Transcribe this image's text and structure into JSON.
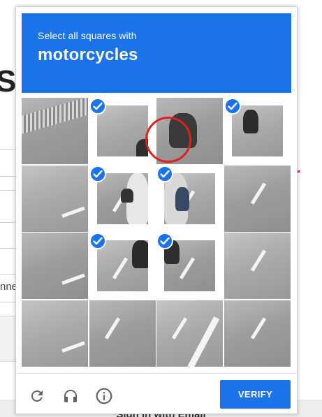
{
  "background_page": {
    "heading_fragment": "Sig",
    "input_fragment": "nne",
    "bottom_button_fragment": "Sign in with Email"
  },
  "captcha": {
    "instruction_line1": "Select all squares with",
    "instruction_target": "motorcycles",
    "tiles": [
      {
        "row": 1,
        "col": 1,
        "selected": false
      },
      {
        "row": 1,
        "col": 2,
        "selected": true
      },
      {
        "row": 1,
        "col": 3,
        "selected": false
      },
      {
        "row": 1,
        "col": 4,
        "selected": true
      },
      {
        "row": 2,
        "col": 1,
        "selected": false
      },
      {
        "row": 2,
        "col": 2,
        "selected": true
      },
      {
        "row": 2,
        "col": 3,
        "selected": true
      },
      {
        "row": 2,
        "col": 4,
        "selected": false
      },
      {
        "row": 3,
        "col": 1,
        "selected": false
      },
      {
        "row": 3,
        "col": 2,
        "selected": true
      },
      {
        "row": 3,
        "col": 3,
        "selected": true
      },
      {
        "row": 3,
        "col": 4,
        "selected": false
      },
      {
        "row": 4,
        "col": 1,
        "selected": false
      },
      {
        "row": 4,
        "col": 2,
        "selected": false
      },
      {
        "row": 4,
        "col": 3,
        "selected": false
      },
      {
        "row": 4,
        "col": 4,
        "selected": false
      }
    ],
    "footer": {
      "reload_icon": "reload-icon",
      "audio_icon": "headphones-icon",
      "info_icon": "info-icon",
      "verify_label": "VERIFY"
    }
  },
  "colors": {
    "accent": "#1a73e8",
    "annotation_red": "#e01f1f"
  }
}
